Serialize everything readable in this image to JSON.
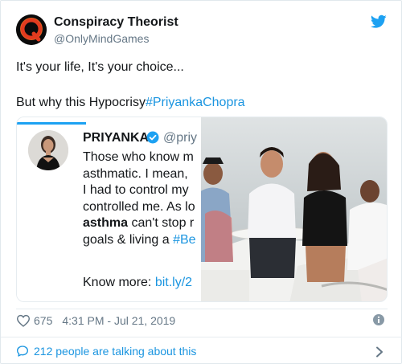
{
  "author": {
    "display_name": "Conspiracy Theorist",
    "handle": "@OnlyMindGames",
    "avatar_letter": "Q"
  },
  "tweet": {
    "line1": "It's your life, It's your choice...",
    "line2_prefix": "But why this Hypocrisy",
    "line2_hashtag": "#PriyankaChopra"
  },
  "embedded_tweet": {
    "name": "PRIYANKA",
    "handle": "@priy",
    "lines": [
      "Those who know m",
      "asthmatic. I mean,",
      "I had to control my",
      "controlled me. As lo"
    ],
    "line5_bold": "asthma",
    "line5_rest": " can't stop r",
    "line6_prefix": "goals & living a ",
    "line6_hashtag": "#Be",
    "know_more_prefix": "Know more: ",
    "know_more_link": "bit.ly/2"
  },
  "stats": {
    "likes": "675",
    "timestamp": "4:31 PM - Jul 21, 2019"
  },
  "footer": {
    "talking": "212 people are talking about this"
  },
  "icons": {
    "platform": "twitter-bird-icon",
    "like": "heart-icon",
    "info": "info-icon",
    "reply": "chat-bubble-icon",
    "chevron": "chevron-right-icon",
    "verified": "verified-badge-icon"
  },
  "colors": {
    "accent": "#1da1f2",
    "link": "#1b95e0",
    "muted": "#657786"
  }
}
